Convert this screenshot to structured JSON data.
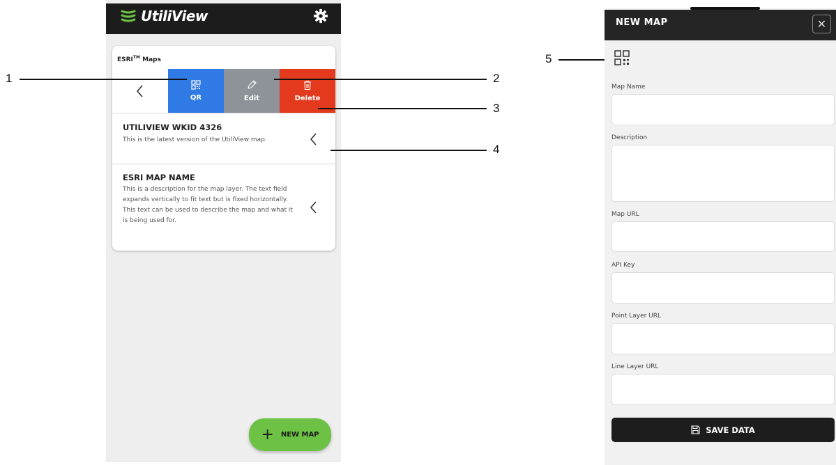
{
  "app": {
    "title": "UtiliView",
    "brand_color": "#6dc144",
    "icons": {
      "logo": "utiliview-logo-icon",
      "settings": "gear-icon"
    }
  },
  "maps_card": {
    "title": "ESRI",
    "title_sup": "TM",
    "title_suffix": " Maps",
    "actions": {
      "qr_label": "QR",
      "edit_label": "Edit",
      "delete_label": "Delete"
    },
    "colors": {
      "qr": "#2f7ae5",
      "edit": "#8d9399",
      "delete": "#e3391c"
    },
    "items": [
      {
        "title": "UTILIVIEW WKID 4326",
        "description": "This is the latest version of the UtiliView map."
      },
      {
        "title": "ESRI MAP NAME",
        "description": "This is a description for the map layer. The text field expands vertically to fit text but is fixed horizontally. This text can be used to describe the map and what it is being used for."
      }
    ]
  },
  "fab": {
    "label": "NEW MAP"
  },
  "callouts": [
    "1",
    "2",
    "3",
    "4",
    "5"
  ],
  "new_map_panel": {
    "title": "NEW MAP",
    "fields": [
      {
        "label": "Map Name",
        "value": ""
      },
      {
        "label": "Description",
        "value": ""
      },
      {
        "label": "Map URL",
        "value": ""
      },
      {
        "label": "API Key",
        "value": ""
      },
      {
        "label": "Point Layer URL",
        "value": ""
      },
      {
        "label": "Line Layer URL",
        "value": ""
      }
    ],
    "save_label": "SAVE DATA"
  }
}
